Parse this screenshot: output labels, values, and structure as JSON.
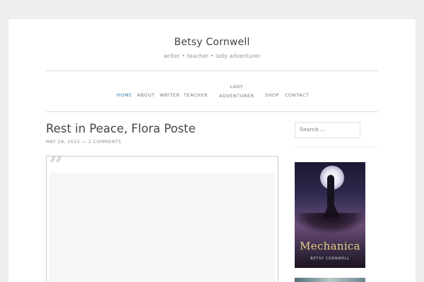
{
  "site": {
    "title": "Betsy Cornwell",
    "description": "writer • teacher • lady adventurer"
  },
  "nav": {
    "items": [
      {
        "label": "HOME",
        "active": true
      },
      {
        "label": "ABOUT"
      },
      {
        "label": "WRITER"
      },
      {
        "label": "TEACHER"
      },
      {
        "label_line1": "LADY",
        "label_line2": "ADVENTURER"
      },
      {
        "label": "SHOP"
      },
      {
        "label": "CONTACT"
      }
    ]
  },
  "post": {
    "title": "Rest in Peace, Flora Poste",
    "date": "MAY 28, 2015",
    "separator": "—",
    "comments": "2 COMMENTS"
  },
  "sidebar": {
    "search_placeholder": "Search …",
    "book": {
      "title": "Mechanica",
      "author": "BETSY CORNWELL"
    }
  },
  "colors": {
    "background": "#eeeeee",
    "nav_active": "#3a7aa2",
    "book_title": "#e7cf84"
  },
  "icons": {
    "quote": "quote-icon"
  }
}
